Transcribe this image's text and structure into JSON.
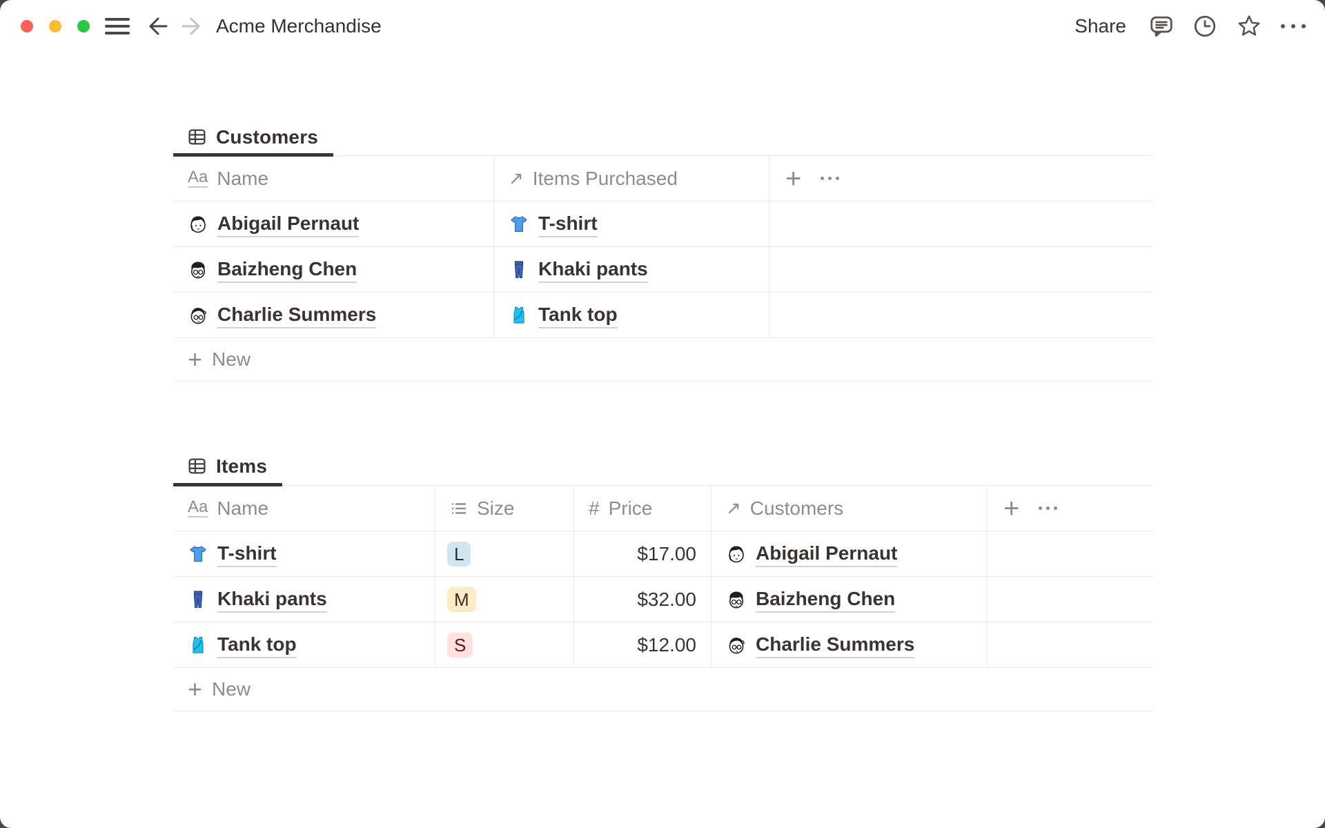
{
  "window": {
    "title": "Acme Merchandise"
  },
  "titlebar": {
    "share_label": "Share",
    "traffic_lights": [
      "close",
      "minimize",
      "zoom"
    ],
    "left_icons": [
      "sidebar-toggle",
      "back",
      "forward"
    ],
    "right_icons": [
      "comments",
      "updates",
      "favorite",
      "more"
    ]
  },
  "customers_section": {
    "tab_label": "Customers",
    "columns": {
      "name": "Name",
      "items_purchased": "Items Purchased"
    },
    "column_types": {
      "name": "text",
      "items_purchased": "relation"
    },
    "rows": [
      {
        "name": "Abigail Pernaut",
        "item_purchased": "T-shirt"
      },
      {
        "name": "Baizheng Chen",
        "item_purchased": "Khaki pants"
      },
      {
        "name": "Charlie Summers",
        "item_purchased": "Tank top"
      }
    ],
    "new_row_label": "New"
  },
  "items_section": {
    "tab_label": "Items",
    "columns": {
      "name": "Name",
      "size": "Size",
      "price": "Price",
      "customers": "Customers"
    },
    "column_types": {
      "name": "text",
      "size": "select",
      "price": "number",
      "customers": "relation"
    },
    "rows": [
      {
        "name": "T-shirt",
        "size": "L",
        "size_color": "blue",
        "price": "$17.00",
        "customer": "Abigail Pernaut"
      },
      {
        "name": "Khaki pants",
        "size": "M",
        "size_color": "yellow",
        "price": "$32.00",
        "customer": "Baizheng Chen"
      },
      {
        "name": "Tank top",
        "size": "S",
        "size_color": "red",
        "price": "$12.00",
        "customer": "Charlie Summers"
      }
    ],
    "new_row_label": "New"
  },
  "colors": {
    "window_backdrop": "#3e4b55",
    "traffic_red": "#fe5f57",
    "traffic_yellow": "#febc2e",
    "traffic_green": "#28c840",
    "text_dark": "#37352f",
    "text_gray": "#8f8d89",
    "table_border": "#ebebe9",
    "tab_underline": "#37352f",
    "chip_blue_bg": "#d3e5ef",
    "chip_blue_text": "#183347",
    "chip_yellow_bg": "#fdecc8",
    "chip_yellow_text": "#402c1b",
    "chip_red_bg": "#ffe2dd",
    "chip_red_text": "#5d1715"
  }
}
